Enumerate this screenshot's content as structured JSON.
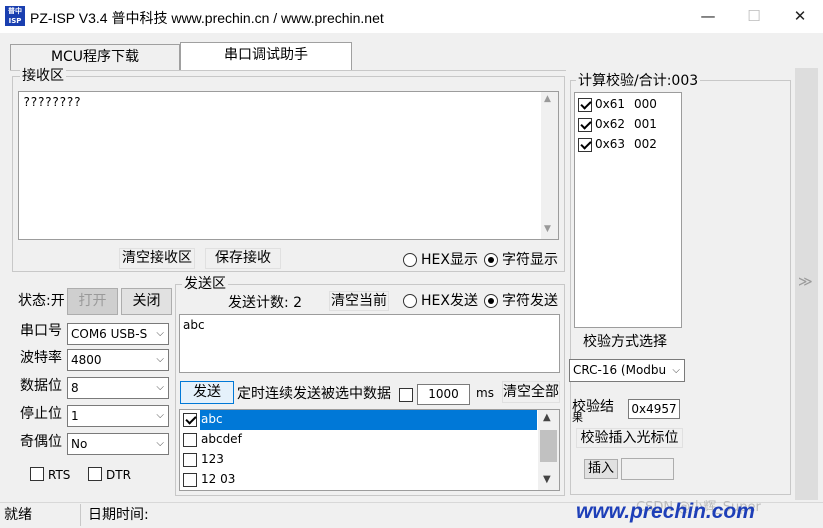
{
  "window": {
    "icon_text": "普中ISP",
    "title": "PZ-ISP V3.4 普中科技 www.prechin.cn / www.prechin.net",
    "minimize": "—",
    "maximize": "☐",
    "close": "✕"
  },
  "tabs": [
    {
      "label": "MCU程序下载",
      "active": false
    },
    {
      "label": "串口调试助手",
      "active": true
    }
  ],
  "receive": {
    "group_label": "接收区",
    "content": "????????",
    "clear_button": "清空接收区",
    "save_button": "保存接收",
    "hex_label": "HEX显示",
    "char_label": "字符显示",
    "mode": "char"
  },
  "port": {
    "status_label": "状态:开",
    "open_button": "打开",
    "close_button": "关闭",
    "port_label": "串口号",
    "port_value": "COM6  USB-S",
    "baud_label": "波特率",
    "baud_value": "4800",
    "data_label": "数据位",
    "data_value": "8",
    "stop_label": "停止位",
    "stop_value": "1",
    "parity_label": "奇偶位",
    "parity_value": "No",
    "rts_label": "RTS",
    "dtr_label": "DTR"
  },
  "send": {
    "group_label": "发送区",
    "count_label": "发送计数: 2",
    "clear_current_button": "清空当前",
    "hex_label": "HEX发送",
    "char_label": "字符发送",
    "mode": "char",
    "content": "abc",
    "send_button": "发送",
    "timed_label": "定时连续发送被选中数据",
    "interval_value": "1000",
    "interval_unit": "ms",
    "clear_all_button": "清空全部",
    "items": [
      {
        "text": "abc",
        "checked": true,
        "selected": true
      },
      {
        "text": "abcdef",
        "checked": false,
        "selected": false
      },
      {
        "text": "123",
        "checked": false,
        "selected": false
      },
      {
        "text": "12 03",
        "checked": false,
        "selected": false
      }
    ]
  },
  "checksum": {
    "group_label": "计算校验/合计:003",
    "items": [
      {
        "hex": "0x61",
        "index": "000",
        "checked": true
      },
      {
        "hex": "0x62",
        "index": "001",
        "checked": true
      },
      {
        "hex": "0x63",
        "index": "002",
        "checked": true
      }
    ],
    "method_label": "校验方式选择",
    "method_value": "CRC-16 (Modbu",
    "result_label": "校验结",
    "result_label2": "果",
    "result_value": "0x4957",
    "insert_cursor_button": "校验插入光标位",
    "insert_button": "插入"
  },
  "side_expand": "≫",
  "statusbar": {
    "ready": "就绪",
    "date_label": "日期时间:",
    "watermark": "CSDN @小辉_Super",
    "brand": "www.prechin.com"
  }
}
